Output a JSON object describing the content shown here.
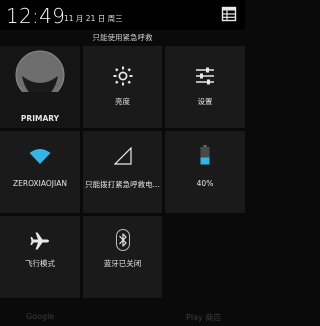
{
  "status_bar": {
    "time": "12:49",
    "date": "11 月 21 日 周三",
    "settings_icon": "quick-settings-list-icon"
  },
  "emergency_notice": "只能使用紧急呼救",
  "quick_settings": {
    "user": {
      "label": "PRIMARY",
      "icon": "user-avatar-icon"
    },
    "brightness": {
      "label": "亮度",
      "icon": "brightness-icon"
    },
    "settings": {
      "label": "设置",
      "icon": "sliders-icon"
    },
    "wifi": {
      "label": "ZEROXIAOJIAN",
      "icon": "wifi-icon"
    },
    "signal": {
      "label": "只能拨打紧急呼救电...",
      "icon": "signal-icon"
    },
    "battery": {
      "label": "40%",
      "icon": "battery-icon",
      "level": 0.4
    },
    "airplane": {
      "label": "飞行模式",
      "icon": "airplane-icon"
    },
    "bluetooth": {
      "label": "蓝牙已关闭",
      "icon": "bluetooth-icon"
    }
  },
  "background_hints": {
    "left": "Google",
    "right": "Play 商店"
  },
  "colors": {
    "accent": "#33b5e5",
    "tile_bg": "#1a1a1a",
    "page_bg": "#0a0a0a"
  }
}
